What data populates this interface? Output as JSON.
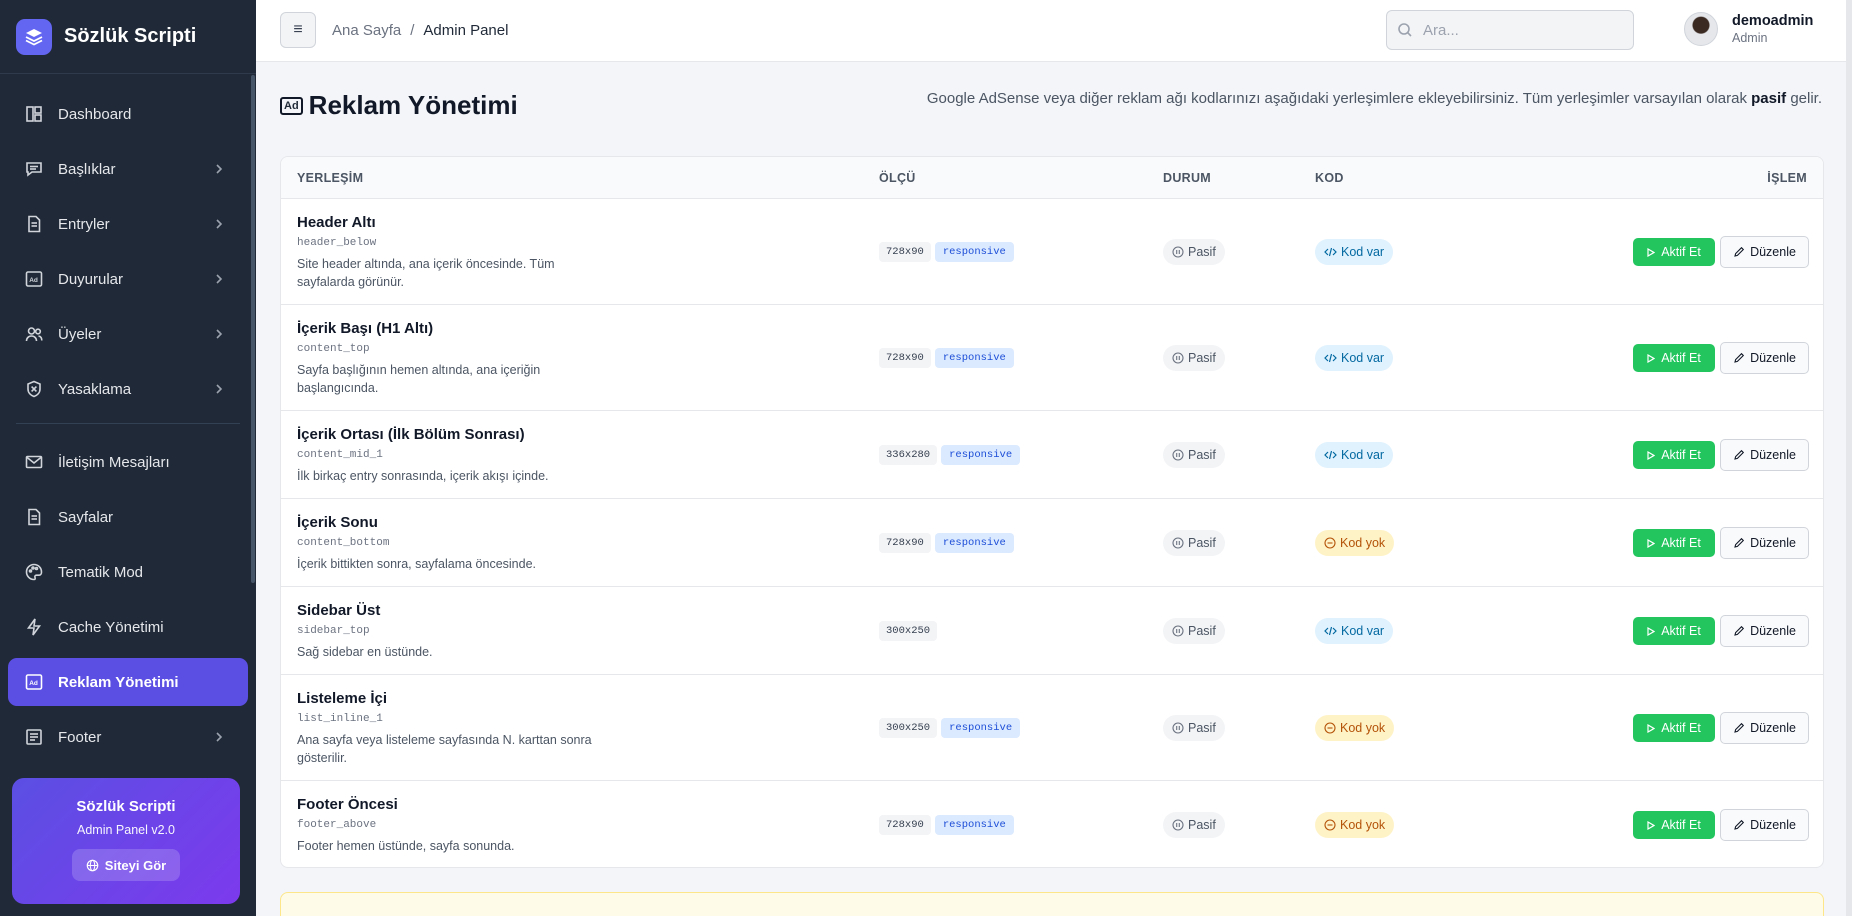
{
  "brand": {
    "title": "Sözlük Scripti",
    "accent": "#6366f1"
  },
  "sidebar": {
    "items": [
      {
        "label": "Dashboard",
        "icon": "dashboard-icon",
        "chevron": false
      },
      {
        "label": "Başlıklar",
        "icon": "topics-icon",
        "chevron": true
      },
      {
        "label": "Entryler",
        "icon": "entries-icon",
        "chevron": true
      },
      {
        "label": "Duyurular",
        "icon": "announcements-icon",
        "chevron": true
      },
      {
        "label": "Üyeler",
        "icon": "users-icon",
        "chevron": true
      },
      {
        "label": "Yasaklama",
        "icon": "ban-shield-icon",
        "chevron": true
      },
      {
        "label": "İletişim Mesajları",
        "icon": "mail-icon",
        "chevron": false
      },
      {
        "label": "Sayfalar",
        "icon": "pages-icon",
        "chevron": false
      },
      {
        "label": "Tematik Mod",
        "icon": "palette-icon",
        "chevron": false
      },
      {
        "label": "Cache Yönetimi",
        "icon": "bolt-icon",
        "chevron": false
      },
      {
        "label": "Reklam Yönetimi",
        "icon": "ad-icon",
        "chevron": false,
        "active": true
      },
      {
        "label": "Footer",
        "icon": "footer-icon",
        "chevron": true
      }
    ],
    "promo": {
      "title": "Sözlük Scripti",
      "subtitle": "Admin Panel v2.0",
      "button": "Siteyi Gör"
    }
  },
  "header": {
    "breadcrumb": [
      "Ana Sayfa",
      "Admin Panel"
    ],
    "search_placeholder": "Ara...",
    "user": {
      "name": "demoadmin",
      "role": "Admin"
    }
  },
  "page": {
    "icon_text": "Ad",
    "title": "Reklam Yönetimi",
    "desc_pre": "Google AdSense veya diğer reklam ağı kodlarınızı aşağıdaki yerleşimlere ekleyebilirsiniz. Tüm yerleşimler varsayılan olarak",
    "desc_bold": "pasif",
    "desc_post": "gelir."
  },
  "table": {
    "columns": {
      "placement": "YERLEŞİM",
      "size": "ÖLÇÜ",
      "status": "DURUM",
      "code": "KOD",
      "action": "İŞLEM"
    },
    "activate_label": "Aktif Et",
    "edit_label": "Düzenle",
    "rows": [
      {
        "name": "Header Altı",
        "key": "header_below",
        "desc": "Site header altında, ana içerik öncesinde. Tüm sayfalarda görünür.",
        "size": "728x90",
        "responsive": "responsive",
        "status": "Pasif",
        "code": "Kod var",
        "has_code": true
      },
      {
        "name": "İçerik Başı (H1 Altı)",
        "key": "content_top",
        "desc": "Sayfa başlığının hemen altında, ana içeriğin başlangıcında.",
        "size": "728x90",
        "responsive": "responsive",
        "status": "Pasif",
        "code": "Kod var",
        "has_code": true
      },
      {
        "name": "İçerik Ortası (İlk Bölüm Sonrası)",
        "key": "content_mid_1",
        "desc": "İlk birkaç entry sonrasında, içerik akışı içinde.",
        "size": "336x280",
        "responsive": "responsive",
        "status": "Pasif",
        "code": "Kod var",
        "has_code": true
      },
      {
        "name": "İçerik Sonu",
        "key": "content_bottom",
        "desc": "İçerik bittikten sonra, sayfalama öncesinde.",
        "size": "728x90",
        "responsive": "responsive",
        "status": "Pasif",
        "code": "Kod yok",
        "has_code": false
      },
      {
        "name": "Sidebar Üst",
        "key": "sidebar_top",
        "desc": "Sağ sidebar en üstünde.",
        "size": "300x250",
        "responsive": "",
        "status": "Pasif",
        "code": "Kod var",
        "has_code": true
      },
      {
        "name": "Listeleme İçi",
        "key": "list_inline_1",
        "desc": "Ana sayfa veya listeleme sayfasında N. karttan sonra gösterilir.",
        "size": "300x250",
        "responsive": "responsive",
        "status": "Pasif",
        "code": "Kod yok",
        "has_code": false
      },
      {
        "name": "Footer Öncesi",
        "key": "footer_above",
        "desc": "Footer hemen üstünde, sayfa sonunda.",
        "size": "728x90",
        "responsive": "responsive",
        "status": "Pasif",
        "code": "Kod yok",
        "has_code": false
      }
    ]
  }
}
